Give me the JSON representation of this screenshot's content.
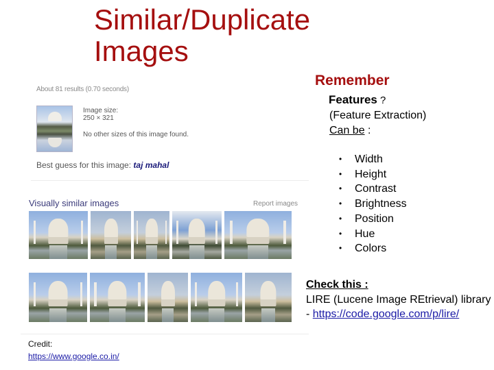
{
  "slide": {
    "title": "Similar/Duplicate Images",
    "accent_color": "#a50f0f"
  },
  "search_panel": {
    "results_count": "About 81 results (0.70 seconds)",
    "image_size_label": "Image size:",
    "image_size_value": "250 × 321",
    "no_other_sizes": "No other sizes of this image found.",
    "best_guess_prefix": "Best guess for this image: ",
    "best_guess_value": "taj mahal",
    "similar_heading": "Visually similar images",
    "report_label": "Report images",
    "thumbnails_row1": [
      "taj mahal",
      "taj mahal",
      "taj mahal",
      "taj mahal",
      "taj mahal"
    ],
    "thumbnails_row2": [
      "taj mahal",
      "taj mahal",
      "taj mahal",
      "taj mahal",
      "taj mahal"
    ]
  },
  "credit": {
    "label": "Credit:",
    "link": "https://www.google.co.in/"
  },
  "notes": {
    "remember": "Remember",
    "features_bold": "Features",
    "features_q": " ?",
    "extraction_text": "(Feature Extraction) ",
    "can_be": "Can be",
    "colon": " :",
    "feature_items": [
      "Width",
      "Height",
      "Contrast",
      "Brightness",
      "Position",
      "Hue",
      "Colors"
    ],
    "bullet": "•",
    "check_title": "Check this :",
    "check_text": "LIRE (Lucene Image REtrieval)  library - ",
    "check_link": "https://code.google.com/p/lire/"
  }
}
